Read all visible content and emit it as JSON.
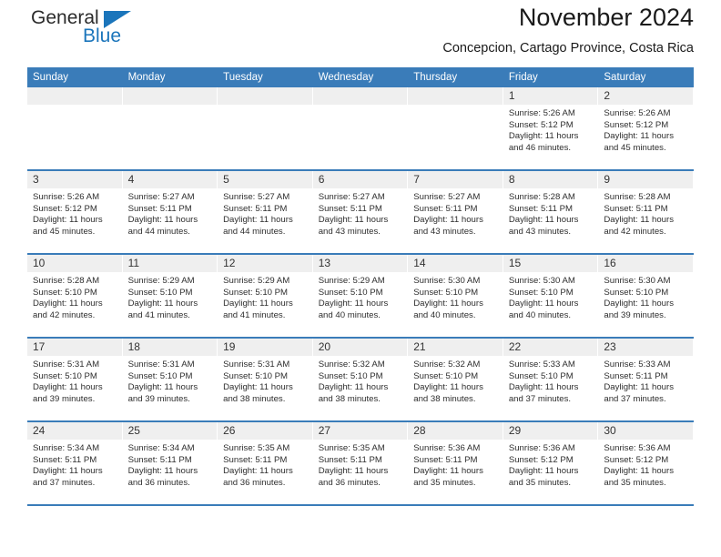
{
  "brand": {
    "name_part1": "General",
    "name_part2": "Blue",
    "logo_icon": "blue-triangle-icon"
  },
  "header": {
    "title": "November 2024",
    "subtitle": "Concepcion, Cartago Province, Costa Rica"
  },
  "colors": {
    "header_blue": "#3a7cb9",
    "brand_blue": "#1b75bb",
    "daynum_band": "#efefef",
    "cell_text": "#2e2e2e"
  },
  "weekday_headers": [
    "Sunday",
    "Monday",
    "Tuesday",
    "Wednesday",
    "Thursday",
    "Friday",
    "Saturday"
  ],
  "labels": {
    "sunrise_prefix": "Sunrise:",
    "sunset_prefix": "Sunset:",
    "daylight_prefix": "Daylight:"
  },
  "weeks": [
    [
      {
        "day": "",
        "empty": true,
        "sunrise": "",
        "sunset": "",
        "daylight": ""
      },
      {
        "day": "",
        "empty": true,
        "sunrise": "",
        "sunset": "",
        "daylight": ""
      },
      {
        "day": "",
        "empty": true,
        "sunrise": "",
        "sunset": "",
        "daylight": ""
      },
      {
        "day": "",
        "empty": true,
        "sunrise": "",
        "sunset": "",
        "daylight": ""
      },
      {
        "day": "",
        "empty": true,
        "sunrise": "",
        "sunset": "",
        "daylight": ""
      },
      {
        "day": "1",
        "empty": false,
        "sunrise": "Sunrise: 5:26 AM",
        "sunset": "Sunset: 5:12 PM",
        "daylight": "Daylight: 11 hours and 46 minutes."
      },
      {
        "day": "2",
        "empty": false,
        "sunrise": "Sunrise: 5:26 AM",
        "sunset": "Sunset: 5:12 PM",
        "daylight": "Daylight: 11 hours and 45 minutes."
      }
    ],
    [
      {
        "day": "3",
        "empty": false,
        "sunrise": "Sunrise: 5:26 AM",
        "sunset": "Sunset: 5:12 PM",
        "daylight": "Daylight: 11 hours and 45 minutes."
      },
      {
        "day": "4",
        "empty": false,
        "sunrise": "Sunrise: 5:27 AM",
        "sunset": "Sunset: 5:11 PM",
        "daylight": "Daylight: 11 hours and 44 minutes."
      },
      {
        "day": "5",
        "empty": false,
        "sunrise": "Sunrise: 5:27 AM",
        "sunset": "Sunset: 5:11 PM",
        "daylight": "Daylight: 11 hours and 44 minutes."
      },
      {
        "day": "6",
        "empty": false,
        "sunrise": "Sunrise: 5:27 AM",
        "sunset": "Sunset: 5:11 PM",
        "daylight": "Daylight: 11 hours and 43 minutes."
      },
      {
        "day": "7",
        "empty": false,
        "sunrise": "Sunrise: 5:27 AM",
        "sunset": "Sunset: 5:11 PM",
        "daylight": "Daylight: 11 hours and 43 minutes."
      },
      {
        "day": "8",
        "empty": false,
        "sunrise": "Sunrise: 5:28 AM",
        "sunset": "Sunset: 5:11 PM",
        "daylight": "Daylight: 11 hours and 43 minutes."
      },
      {
        "day": "9",
        "empty": false,
        "sunrise": "Sunrise: 5:28 AM",
        "sunset": "Sunset: 5:11 PM",
        "daylight": "Daylight: 11 hours and 42 minutes."
      }
    ],
    [
      {
        "day": "10",
        "empty": false,
        "sunrise": "Sunrise: 5:28 AM",
        "sunset": "Sunset: 5:10 PM",
        "daylight": "Daylight: 11 hours and 42 minutes."
      },
      {
        "day": "11",
        "empty": false,
        "sunrise": "Sunrise: 5:29 AM",
        "sunset": "Sunset: 5:10 PM",
        "daylight": "Daylight: 11 hours and 41 minutes."
      },
      {
        "day": "12",
        "empty": false,
        "sunrise": "Sunrise: 5:29 AM",
        "sunset": "Sunset: 5:10 PM",
        "daylight": "Daylight: 11 hours and 41 minutes."
      },
      {
        "day": "13",
        "empty": false,
        "sunrise": "Sunrise: 5:29 AM",
        "sunset": "Sunset: 5:10 PM",
        "daylight": "Daylight: 11 hours and 40 minutes."
      },
      {
        "day": "14",
        "empty": false,
        "sunrise": "Sunrise: 5:30 AM",
        "sunset": "Sunset: 5:10 PM",
        "daylight": "Daylight: 11 hours and 40 minutes."
      },
      {
        "day": "15",
        "empty": false,
        "sunrise": "Sunrise: 5:30 AM",
        "sunset": "Sunset: 5:10 PM",
        "daylight": "Daylight: 11 hours and 40 minutes."
      },
      {
        "day": "16",
        "empty": false,
        "sunrise": "Sunrise: 5:30 AM",
        "sunset": "Sunset: 5:10 PM",
        "daylight": "Daylight: 11 hours and 39 minutes."
      }
    ],
    [
      {
        "day": "17",
        "empty": false,
        "sunrise": "Sunrise: 5:31 AM",
        "sunset": "Sunset: 5:10 PM",
        "daylight": "Daylight: 11 hours and 39 minutes."
      },
      {
        "day": "18",
        "empty": false,
        "sunrise": "Sunrise: 5:31 AM",
        "sunset": "Sunset: 5:10 PM",
        "daylight": "Daylight: 11 hours and 39 minutes."
      },
      {
        "day": "19",
        "empty": false,
        "sunrise": "Sunrise: 5:31 AM",
        "sunset": "Sunset: 5:10 PM",
        "daylight": "Daylight: 11 hours and 38 minutes."
      },
      {
        "day": "20",
        "empty": false,
        "sunrise": "Sunrise: 5:32 AM",
        "sunset": "Sunset: 5:10 PM",
        "daylight": "Daylight: 11 hours and 38 minutes."
      },
      {
        "day": "21",
        "empty": false,
        "sunrise": "Sunrise: 5:32 AM",
        "sunset": "Sunset: 5:10 PM",
        "daylight": "Daylight: 11 hours and 38 minutes."
      },
      {
        "day": "22",
        "empty": false,
        "sunrise": "Sunrise: 5:33 AM",
        "sunset": "Sunset: 5:10 PM",
        "daylight": "Daylight: 11 hours and 37 minutes."
      },
      {
        "day": "23",
        "empty": false,
        "sunrise": "Sunrise: 5:33 AM",
        "sunset": "Sunset: 5:11 PM",
        "daylight": "Daylight: 11 hours and 37 minutes."
      }
    ],
    [
      {
        "day": "24",
        "empty": false,
        "sunrise": "Sunrise: 5:34 AM",
        "sunset": "Sunset: 5:11 PM",
        "daylight": "Daylight: 11 hours and 37 minutes."
      },
      {
        "day": "25",
        "empty": false,
        "sunrise": "Sunrise: 5:34 AM",
        "sunset": "Sunset: 5:11 PM",
        "daylight": "Daylight: 11 hours and 36 minutes."
      },
      {
        "day": "26",
        "empty": false,
        "sunrise": "Sunrise: 5:35 AM",
        "sunset": "Sunset: 5:11 PM",
        "daylight": "Daylight: 11 hours and 36 minutes."
      },
      {
        "day": "27",
        "empty": false,
        "sunrise": "Sunrise: 5:35 AM",
        "sunset": "Sunset: 5:11 PM",
        "daylight": "Daylight: 11 hours and 36 minutes."
      },
      {
        "day": "28",
        "empty": false,
        "sunrise": "Sunrise: 5:36 AM",
        "sunset": "Sunset: 5:11 PM",
        "daylight": "Daylight: 11 hours and 35 minutes."
      },
      {
        "day": "29",
        "empty": false,
        "sunrise": "Sunrise: 5:36 AM",
        "sunset": "Sunset: 5:12 PM",
        "daylight": "Daylight: 11 hours and 35 minutes."
      },
      {
        "day": "30",
        "empty": false,
        "sunrise": "Sunrise: 5:36 AM",
        "sunset": "Sunset: 5:12 PM",
        "daylight": "Daylight: 11 hours and 35 minutes."
      }
    ]
  ]
}
